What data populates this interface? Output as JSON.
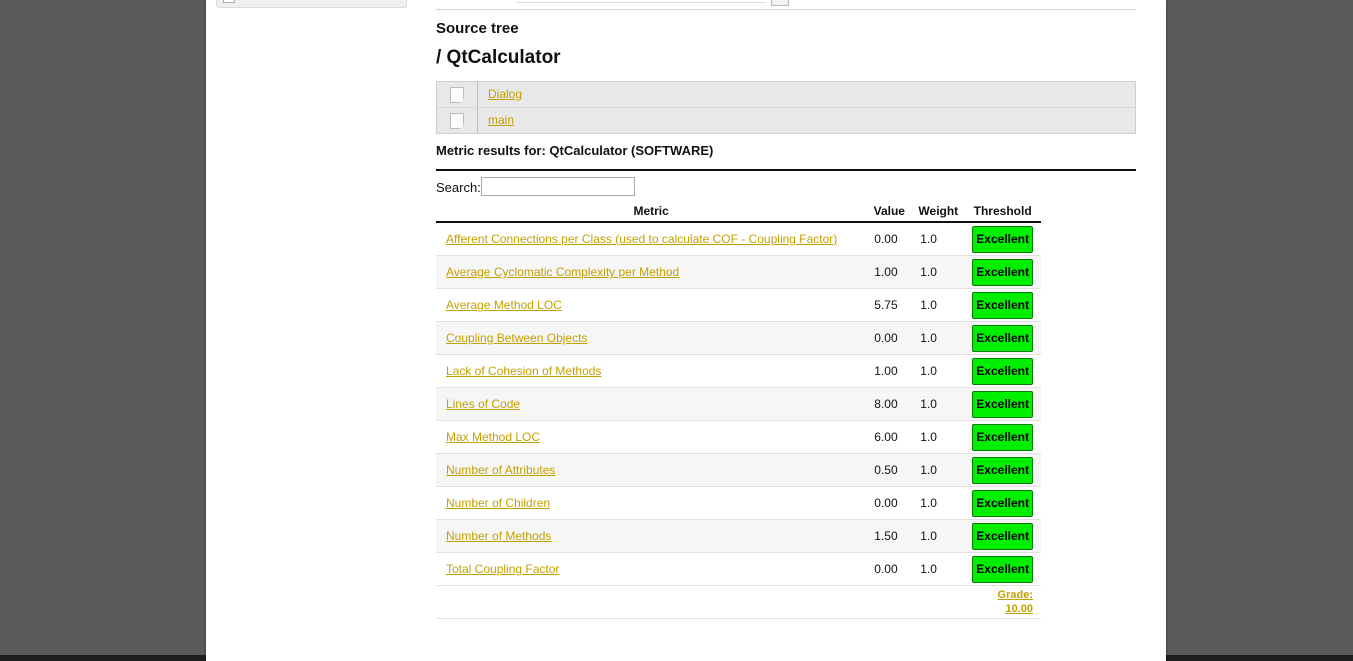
{
  "source_tree": {
    "label": "Source tree",
    "title": "/ QtCalculator",
    "items": [
      {
        "icon": "file-icon",
        "label": "Dialog"
      },
      {
        "icon": "file-icon",
        "label": "main"
      }
    ]
  },
  "metrics": {
    "heading": "Metric results for: QtCalculator (SOFTWARE)",
    "search_label": "Search:",
    "search_value": "",
    "columns": [
      "Metric",
      "Value",
      "Weight",
      "Threshold"
    ],
    "rows": [
      {
        "metric": "Afferent Connections per Class (used to calculate COF - Coupling Factor)",
        "value": "0.00",
        "weight": "1.0",
        "threshold": "Excellent"
      },
      {
        "metric": "Average Cyclomatic Complexity per Method",
        "value": "1.00",
        "weight": "1.0",
        "threshold": "Excellent"
      },
      {
        "metric": "Average Method LOC",
        "value": "5.75",
        "weight": "1.0",
        "threshold": "Excellent"
      },
      {
        "metric": "Coupling Between Objects",
        "value": "0.00",
        "weight": "1.0",
        "threshold": "Excellent"
      },
      {
        "metric": "Lack of Cohesion of Methods",
        "value": "1.00",
        "weight": "1.0",
        "threshold": "Excellent"
      },
      {
        "metric": "Lines of Code",
        "value": "8.00",
        "weight": "1.0",
        "threshold": "Excellent"
      },
      {
        "metric": "Max Method LOC",
        "value": "6.00",
        "weight": "1.0",
        "threshold": "Excellent"
      },
      {
        "metric": "Number of Attributes",
        "value": "0.50",
        "weight": "1.0",
        "threshold": "Excellent"
      },
      {
        "metric": "Number of Children",
        "value": "0.00",
        "weight": "1.0",
        "threshold": "Excellent"
      },
      {
        "metric": "Number of Methods",
        "value": "1.50",
        "weight": "1.0",
        "threshold": "Excellent"
      },
      {
        "metric": "Total Coupling Factor",
        "value": "0.00",
        "weight": "1.0",
        "threshold": "Excellent"
      }
    ],
    "grade_label": "Grade:",
    "grade_value": "10.00"
  },
  "colors": {
    "link": "#c4a000",
    "excellent_badge": "#00ee00",
    "backdrop": "#5a5a5a"
  }
}
